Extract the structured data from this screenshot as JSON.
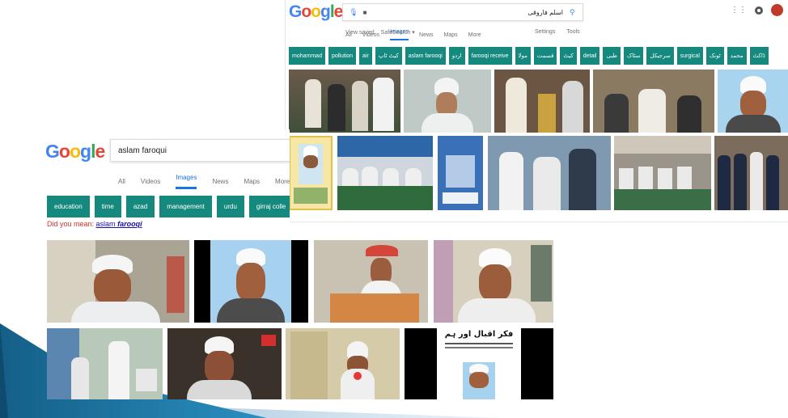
{
  "back_screenshot": {
    "logo": "Google",
    "query": "اسلم فاروقی",
    "tabs": {
      "all": "All",
      "videos": "Videos",
      "images": "Images",
      "news": "News",
      "maps": "Maps",
      "more": "More"
    },
    "tools": {
      "settings": "Settings",
      "tools": "Tools"
    },
    "view_saved": "View saved",
    "safesearch": "SafeSearch ▾",
    "chips": [
      "mohammad",
      "pollution",
      "air",
      "کیٹ ٹاپ",
      "aslam farooqi",
      "اردو",
      "farooqi receive",
      "مولا",
      "قسمت",
      "کیٹ",
      "detail",
      "طبی",
      "سٹاک",
      "سرجیکل",
      "surgical",
      "ٹونک",
      "محمد",
      "ڈاکٹ"
    ]
  },
  "front_screenshot": {
    "logo": "Google",
    "query": "aslam faroqui",
    "tabs": {
      "all": "All",
      "videos": "Videos",
      "images": "Images",
      "news": "News",
      "maps": "Maps",
      "more": "More"
    },
    "chips": [
      "education",
      "time",
      "azad",
      "management",
      "urdu",
      "girraj colle"
    ],
    "did_you_mean_prefix": "Did you mean:",
    "did_you_mean_term": "aslam",
    "did_you_mean_bold": "farooqi"
  },
  "poster": {
    "title": "فکر اقبال اور ہم"
  },
  "colors": {
    "chip": "#15897d",
    "active_tab": "#1a73e8",
    "did_you_mean": "#d93025",
    "link": "#1a0dab",
    "deco_dark": "#1a6e99",
    "deco_light": "#c9dcea"
  }
}
